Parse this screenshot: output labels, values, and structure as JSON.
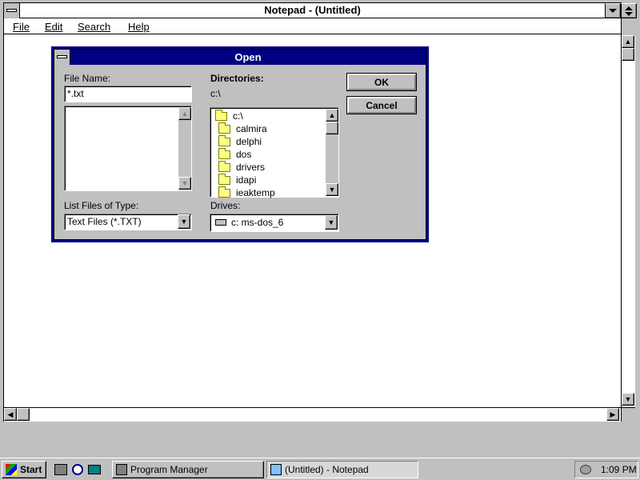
{
  "notepad": {
    "title": "Notepad - (Untitled)",
    "menu": [
      "File",
      "Edit",
      "Search",
      "Help"
    ],
    "sys_icon": "window-control-icon",
    "minimize_icon": "minimize-icon",
    "maximize_icon": "maximize-icon"
  },
  "dialog": {
    "title": "Open",
    "file_name_label": "File Name:",
    "file_name_value": "*.txt",
    "directories_label": "Directories:",
    "current_dir": "c:\\",
    "dir_root": "c:\\",
    "directories": [
      "calmira",
      "delphi",
      "dos",
      "drivers",
      "idapi",
      "ieaktemp"
    ],
    "list_type_label": "List Files of Type:",
    "list_type_value": "Text Files (*.TXT)",
    "drives_label": "Drives:",
    "drives_value": "c: ms-dos_6",
    "ok_label": "OK",
    "cancel_label": "Cancel"
  },
  "taskbar": {
    "start_label": "Start",
    "tasks": [
      "Program Manager",
      "(Untitled) - Notepad"
    ],
    "active_task_index": 1,
    "clock": "1:09 PM",
    "quick_launch_icons": [
      "printer-icon",
      "find-icon",
      "folder-icon"
    ]
  },
  "colors": {
    "title_active": "#000080",
    "face": "#c0c0c0",
    "window": "#ffffff"
  }
}
